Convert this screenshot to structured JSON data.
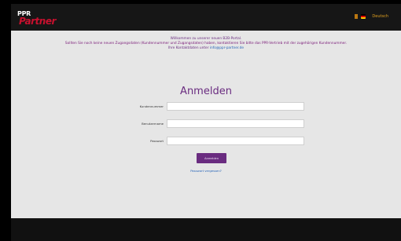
{
  "header": {
    "logo_top": "PPR",
    "logo_bottom": "Partner",
    "language_label": "Deutsch",
    "language_icon": "german-flag-icon"
  },
  "notice": {
    "line1": "Willkommen zu unserer neuen B2B-Portal.",
    "line2": "Sollten Sie noch keine neuen Zugangsdaten (Kundennummer und Zugangsdaten) haben, kontaktieren Sie bitte das PPR-Vertrieb mit der zugehörigen Kundennummer.",
    "line3_text": "Ihre Kontaktdaten unter",
    "line3_link": "info@ppr-partner.de"
  },
  "login": {
    "title": "Anmelden",
    "fields": [
      {
        "label": "Kundennummer",
        "value": "",
        "type": "text"
      },
      {
        "label": "Benutzername",
        "value": "",
        "type": "text"
      },
      {
        "label": "Passwort",
        "value": "",
        "type": "password"
      }
    ],
    "submit_label": "Anmelden",
    "forgot_label": "Passwort vergessen?"
  },
  "colors": {
    "accent": "#6a2c80",
    "link": "#2563b8",
    "header_bg": "#161616",
    "page_bg": "#e6e6e6"
  }
}
